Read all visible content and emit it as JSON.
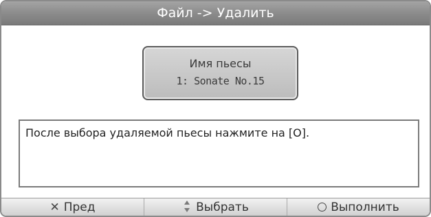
{
  "window": {
    "title": "Файл -> Удалить"
  },
  "piece": {
    "label": "Имя пьесы",
    "name": "1: Sonate No.15"
  },
  "message": {
    "text": "После выбора удаляемой пьесы нажмите на [O]."
  },
  "softkeys": [
    {
      "label": "Пред",
      "icon": "close-icon"
    },
    {
      "label": "Выбрать",
      "icon": "up-down-arrows-icon"
    },
    {
      "label": "Выполнить",
      "icon": "circle-icon"
    }
  ]
}
